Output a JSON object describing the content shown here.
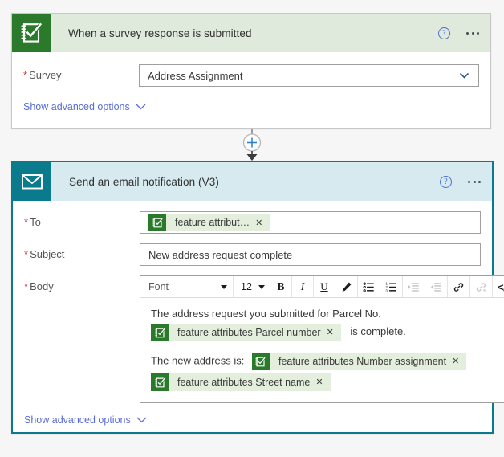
{
  "palette": {
    "page_background": "#f6f6f6",
    "trigger_header_background": "#dfe9dc",
    "trigger_icon_background": "#2b7a2b",
    "action_header_background": "#d6eaef",
    "action_icon_background": "#0a7b8d",
    "action_border": "#0a7b8d",
    "token_background": "#e3eedd",
    "link_blue": "#5b6ed6",
    "required_red": "#d13438",
    "help_blue": "#4a6fd4"
  },
  "trigger_card": {
    "icon_name": "survey123-icon",
    "title": "When a survey response is submitted",
    "help_label": "?",
    "more_label": "...",
    "fields": [
      {
        "label": "Survey",
        "required": true,
        "value": "Address Assignment",
        "control": "dropdown"
      }
    ],
    "advanced_options_label": "Show advanced options"
  },
  "connector": {
    "add_step_label": "+",
    "icon_name": "add-step-button"
  },
  "action_card": {
    "icon_name": "email-envelope-icon",
    "title": "Send an email notification (V3)",
    "help_label": "?",
    "more_label": "...",
    "to_field": {
      "label": "To",
      "required": true,
      "tokens": [
        {
          "text": "feature attribut…",
          "remove_label": "✕",
          "icon_name": "survey123-token-icon"
        }
      ]
    },
    "subject_field": {
      "label": "Subject",
      "required": true,
      "value": "New address request complete"
    },
    "body_field": {
      "label": "Body",
      "required": true,
      "toolbar": {
        "font_name": "Font",
        "font_size": "12",
        "bold_label": "B",
        "italic_label": "I",
        "underline_label": "U",
        "text_color_icon": "pen-highlight-icon",
        "bulleted_list_icon": "bulleted-list-icon",
        "numbered_list_icon": "numbered-list-icon",
        "indent_icon": "increase-indent-icon",
        "outdent_icon": "decrease-indent-icon",
        "link_icon": "link-icon",
        "unlink_icon": "unlink-icon",
        "code_label": "</>"
      },
      "content": {
        "line1_text": "The address request you submitted for Parcel No.",
        "line2_token": "feature attributes Parcel number",
        "line2_token_remove": "✕",
        "line2_trailing_text": "is complete.",
        "line3_text": "The new address is:",
        "line3_token": "feature attributes Number assignment",
        "line3_token_remove": "✕",
        "line4_token": "feature attributes Street name",
        "line4_token_remove": "✕"
      }
    },
    "advanced_options_label": "Show advanced options"
  }
}
